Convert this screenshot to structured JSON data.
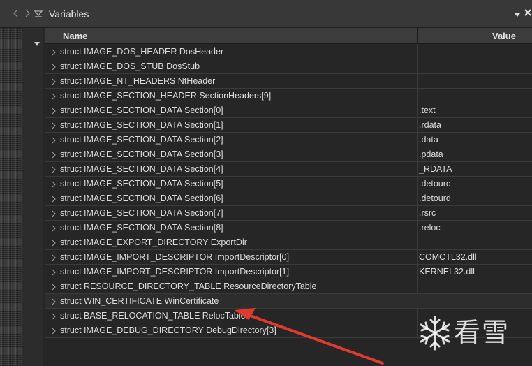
{
  "panel": {
    "title": "Variables",
    "back_icon": "chevron-left-icon",
    "forward_icon": "chevron-right-icon",
    "collapse_icon": "triangle-down-icon",
    "menu_icon": "dropdown-menu-icon",
    "close_icon": "close-icon"
  },
  "table": {
    "columns": [
      "Name",
      "Value"
    ],
    "rows": [
      {
        "name": "struct IMAGE_DOS_HEADER DosHeader",
        "value": ""
      },
      {
        "name": "struct IMAGE_DOS_STUB DosStub",
        "value": ""
      },
      {
        "name": "struct IMAGE_NT_HEADERS NtHeader",
        "value": ""
      },
      {
        "name": "struct IMAGE_SECTION_HEADER SectionHeaders[9]",
        "value": ""
      },
      {
        "name": "struct IMAGE_SECTION_DATA Section[0]",
        "value": ".text"
      },
      {
        "name": "struct IMAGE_SECTION_DATA Section[1]",
        "value": ".rdata"
      },
      {
        "name": "struct IMAGE_SECTION_DATA Section[2]",
        "value": ".data"
      },
      {
        "name": "struct IMAGE_SECTION_DATA Section[3]",
        "value": ".pdata"
      },
      {
        "name": "struct IMAGE_SECTION_DATA Section[4]",
        "value": "_RDATA"
      },
      {
        "name": "struct IMAGE_SECTION_DATA Section[5]",
        "value": ".detourc"
      },
      {
        "name": "struct IMAGE_SECTION_DATA Section[6]",
        "value": ".detourd"
      },
      {
        "name": "struct IMAGE_SECTION_DATA Section[7]",
        "value": ".rsrc"
      },
      {
        "name": "struct IMAGE_SECTION_DATA Section[8]",
        "value": ".reloc"
      },
      {
        "name": "struct IMAGE_EXPORT_DIRECTORY ExportDir",
        "value": ""
      },
      {
        "name": "struct IMAGE_IMPORT_DESCRIPTOR ImportDescriptor[0]",
        "value": "COMCTL32.dll"
      },
      {
        "name": "struct IMAGE_IMPORT_DESCRIPTOR ImportDescriptor[1]",
        "value": "KERNEL32.dll"
      },
      {
        "name": "struct RESOURCE_DIRECTORY_TABLE ResourceDirectoryTable",
        "value": ""
      },
      {
        "name": "struct WIN_CERTIFICATE WinCertificate",
        "value": "",
        "highlighted": true
      },
      {
        "name": "struct BASE_RELOCATION_TABLE RelocTable",
        "value": ""
      },
      {
        "name": "struct IMAGE_DEBUG_DIRECTORY DebugDirectory[3]",
        "value": ""
      }
    ]
  },
  "annotation": {
    "arrow_color": "#e03a2e",
    "points_to": "struct WIN_CERTIFICATE WinCertificate"
  },
  "watermark": {
    "text": "看雪",
    "icon": "snowflake-icon"
  },
  "colors": {
    "background": "#262626",
    "titlebar": "#383838",
    "header": "#3c3c3c",
    "text": "#dcdcdc"
  }
}
